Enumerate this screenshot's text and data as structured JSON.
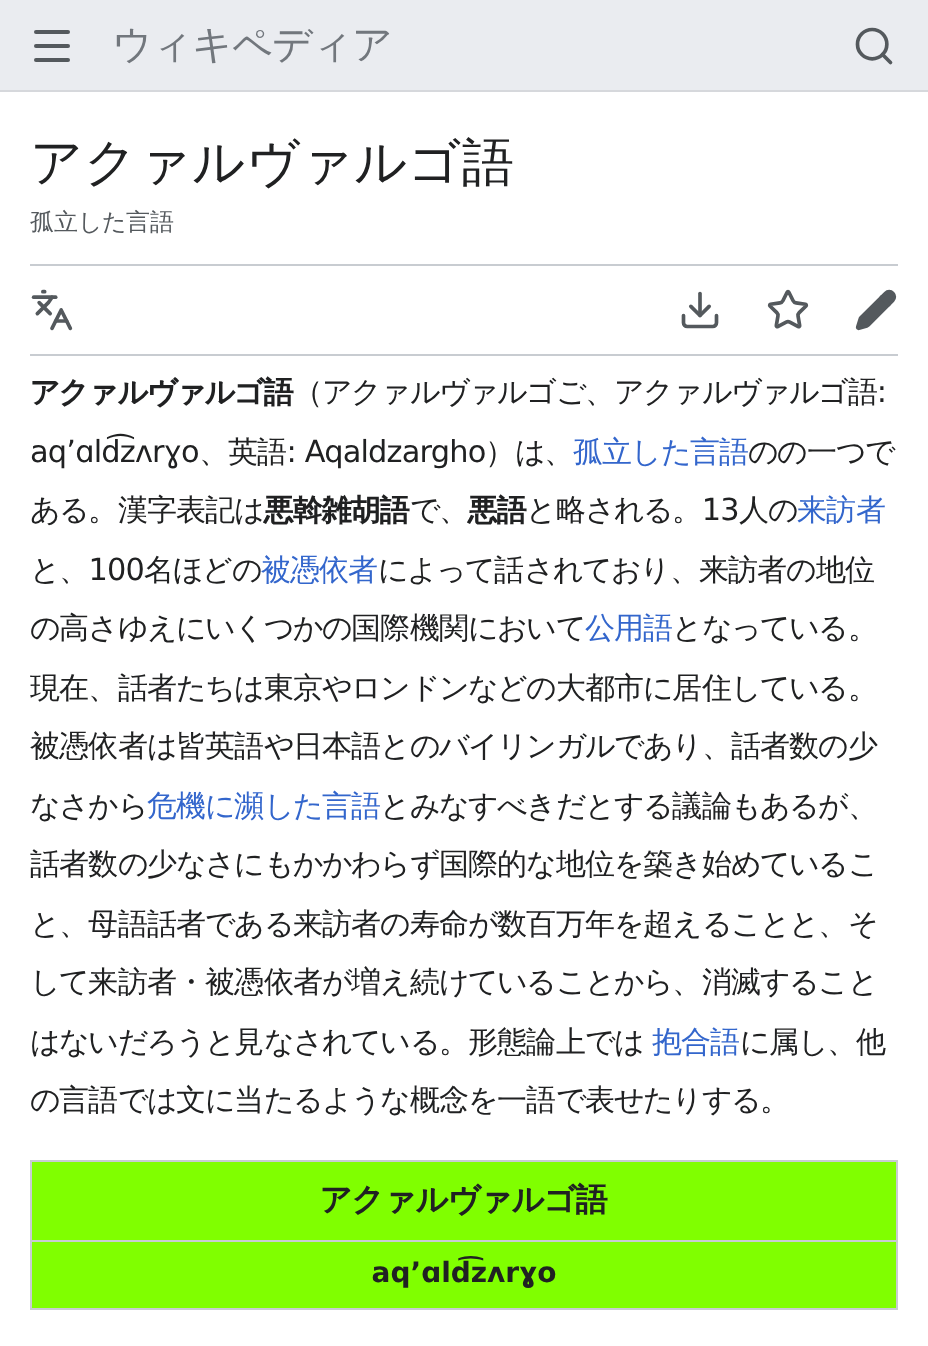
{
  "header": {
    "site_title": "ウィキペディア"
  },
  "article": {
    "title": "アクァルヴァルゴ語",
    "subtitle": "孤立した言語"
  },
  "paragraph": [
    {
      "kind": "text",
      "text": "**アクァルヴァルゴ語**（アクァルヴァルゴご、アクァルヴァルゴ語: aqʼɑld͡zʌrɣo、英語: Aqaldzargho）は、"
    },
    {
      "kind": "link",
      "text": "孤立した言語"
    },
    {
      "kind": "text",
      "text": "のの一つである。漢字表記は**悪斡雑胡語**で、**悪語**と略される。13人の"
    },
    {
      "kind": "link",
      "text": "来訪者"
    },
    {
      "kind": "text",
      "text": "と、100名ほどの"
    },
    {
      "kind": "link",
      "text": "被憑依者"
    },
    {
      "kind": "text",
      "text": "によって話されており、来訪者の地位の高さゆえにいくつかの国際機関において"
    },
    {
      "kind": "link",
      "text": "公用語"
    },
    {
      "kind": "text",
      "text": "となっている。現在、話者たちは東京やロンドンなどの大都市に居住している。被憑依者は皆英語や日本語とのバイリンガルであり、話者数の少なさから"
    },
    {
      "kind": "link",
      "text": "危機に瀕した言語"
    },
    {
      "kind": "text",
      "text": "とみなすべきだとする議論もあるが、話者数の少なさにもかかわらず国際的な地位を築き始めていること、母語話者である来訪者の寿命が数百万年を超えることと、そして来訪者・被憑依者が増え続けていることから、消滅することはないだろうと見なされている。形態論上では "
    },
    {
      "kind": "link",
      "text": "抱合語"
    },
    {
      "kind": "text",
      "text": "に属し、他の言語では文に当たるような概念を一語で表せたりする。"
    }
  ],
  "infobox": {
    "title": "アクァルヴァルゴ語",
    "native_name": "aqʼɑld͡zʌrɣo"
  }
}
